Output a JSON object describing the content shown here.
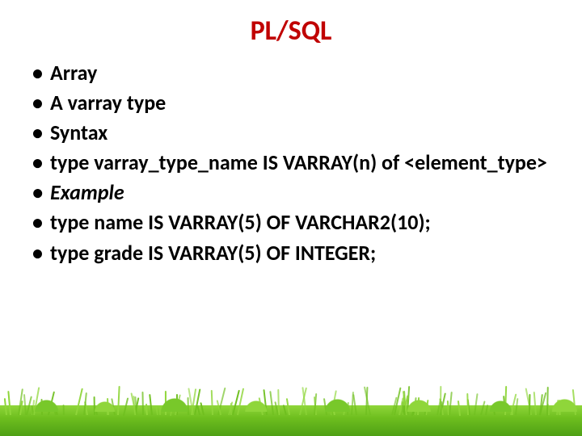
{
  "title": "PL/SQL",
  "bullets": {
    "b0": "Array",
    "b1": "A varray type",
    "b2": "Syntax",
    "b3": "type varray_type_name IS VARRAY(n) of <element_type>",
    "b4": "Example",
    "b5": "type name IS VARRAY(5) OF VARCHAR2(10);",
    "b6": "type grade IS VARRAY(5) OF INTEGER;"
  }
}
